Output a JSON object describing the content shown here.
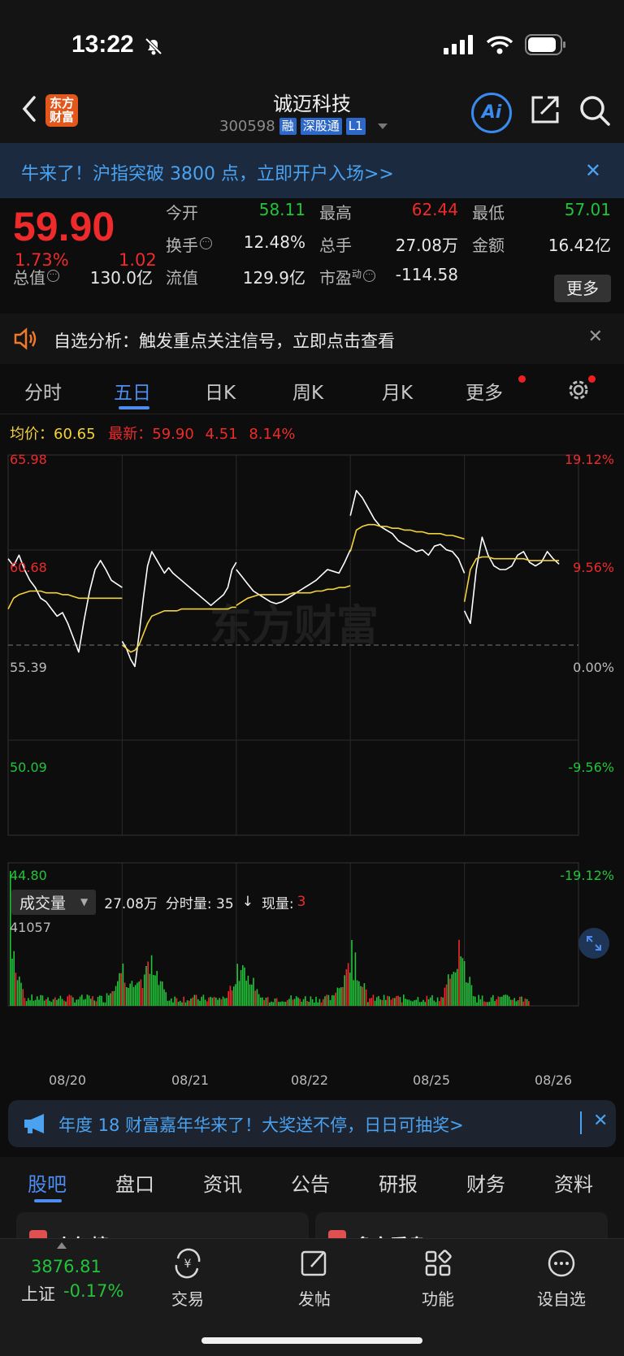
{
  "status": {
    "time": "13:22"
  },
  "header": {
    "logo_text_1": "东方",
    "logo_text_2": "财富",
    "stock_name": "诚迈科技",
    "stock_code": "300598",
    "tags": [
      "融",
      "深股通",
      "L1"
    ],
    "ai_label": "Ai"
  },
  "banner": {
    "text": "牛来了！沪指突破 3800 点，立即开户入场>>",
    "close": "✕"
  },
  "quote": {
    "price": "59.90",
    "change_pct": "1.73%",
    "change": "1.02",
    "open_label": "今开",
    "open": "58.11",
    "high_label": "最高",
    "high": "62.44",
    "low_label": "最低",
    "low": "57.01",
    "turnover_label": "换手",
    "turnover": "12.48%",
    "volume_label": "总手",
    "volume": "27.08万",
    "amount_label": "金额",
    "amount": "16.42亿",
    "mktcap_label": "总值",
    "mktcap": "130.0亿",
    "float_label": "流值",
    "float_cap": "129.9亿",
    "pe_label": "市盈",
    "pe_sup": "动",
    "pe": "-114.58",
    "more_label": "更多"
  },
  "alert": {
    "text": "自选分析：触发重点关注信号，立即点击查看",
    "close": "✕"
  },
  "tabs": [
    "分时",
    "五日",
    "日K",
    "周K",
    "月K",
    "更多"
  ],
  "active_tab": "五日",
  "summary": {
    "avg_label": "均价：",
    "avg": "60.65",
    "latest_label": "最新：",
    "latest": "59.90",
    "chg": "4.51",
    "chg_pct": "8.14%"
  },
  "chart_data": {
    "type": "line",
    "title": "",
    "x_labels": [
      "08/20",
      "08/21",
      "08/22",
      "08/25",
      "08/26"
    ],
    "y_ticks": [
      "65.98",
      "60.68",
      "55.39",
      "50.09",
      "44.80"
    ],
    "y_pct_ticks": [
      "19.12%",
      "9.56%",
      "0.00%",
      "-9.56%",
      "-19.12%"
    ],
    "ylim": [
      44.8,
      65.98
    ],
    "prev_close": 55.39,
    "series": [
      {
        "name": "",
        "color": "#ffffff",
        "values": [
          60.2,
          59.8,
          60.4,
          59.6,
          59.0,
          58.6,
          58.0,
          57.8,
          57.4,
          57.0,
          57.2,
          56.6,
          55.8,
          55.0,
          56.8,
          58.4,
          59.6,
          60.1,
          59.6,
          59.0,
          58.8,
          58.6,
          55.6,
          55.2,
          54.6,
          54.2,
          56.0,
          58.0,
          59.8,
          60.6,
          60.2,
          59.8,
          59.4,
          59.7,
          59.4,
          59.2,
          59.0,
          58.8,
          58.6,
          58.4,
          58.2,
          58.0,
          57.8,
          57.6,
          57.8,
          58.0,
          58.2,
          58.6,
          59.6,
          60.0,
          59.6,
          59.2,
          58.8,
          58.4,
          58.2,
          58.0,
          57.8,
          57.7,
          57.8,
          58.0,
          58.2,
          58.4,
          58.6,
          58.8,
          59.0,
          59.3,
          59.6,
          59.5,
          59.4,
          60.0,
          60.7,
          62.6,
          64.0,
          63.6,
          63.0,
          62.4,
          62.0,
          61.8,
          61.6,
          61.2,
          61.0,
          60.8,
          60.6,
          60.7,
          60.4,
          60.9,
          61.0,
          60.7,
          60.6,
          60.2,
          59.4,
          57.3,
          56.6,
          59.6,
          61.4,
          60.4,
          59.8,
          59.6,
          59.6,
          59.8,
          60.4,
          60.6,
          60.0,
          59.8,
          60.0,
          60.6,
          60.2,
          59.9
        ]
      },
      {
        "name": "",
        "color": "#f3d13a",
        "values": [
          57.4,
          58.0,
          58.2,
          58.3,
          58.4,
          58.4,
          58.4,
          58.3,
          58.3,
          58.3,
          58.2,
          58.2,
          58.1,
          58.0,
          58.0,
          58.0,
          58.0,
          58.0,
          58.0,
          58.0,
          58.0,
          58.0,
          55.4,
          55.2,
          55.0,
          55.1,
          55.4,
          56.0,
          56.6,
          57.0,
          57.1,
          57.2,
          57.3,
          57.3,
          57.3,
          57.3,
          57.4,
          57.4,
          57.4,
          57.4,
          57.4,
          57.4,
          57.4,
          57.4,
          57.4,
          57.4,
          57.4,
          57.4,
          57.5,
          57.5,
          57.6,
          57.8,
          58.0,
          58.1,
          58.2,
          58.2,
          58.2,
          58.2,
          58.2,
          58.2,
          58.3,
          58.3,
          58.3,
          58.3,
          58.4,
          58.4,
          58.5,
          58.5,
          58.6,
          58.6,
          58.7,
          60.6,
          61.8,
          62.0,
          62.1,
          62.1,
          62.0,
          62.0,
          61.9,
          61.9,
          61.8,
          61.8,
          61.7,
          61.7,
          61.6,
          61.6,
          61.6,
          61.5,
          61.5,
          61.4,
          61.3,
          57.8,
          59.6,
          60.2,
          60.3,
          60.3,
          60.2,
          60.2,
          60.2,
          60.2,
          60.2,
          60.2,
          60.1,
          60.1,
          60.1,
          60.1,
          60.1,
          60.1
        ]
      }
    ],
    "grid": true
  },
  "volume": {
    "selector_label": "成交量",
    "total": "27.08万",
    "tick_label": "分时量: 35",
    "arrow": "↓",
    "now_label": "现量:",
    "now_val": "3",
    "max": "41057"
  },
  "promo": {
    "text": "年度 18 财富嘉年华来了！大奖送不停，日日可抽奖>",
    "close": "✕"
  },
  "bottom_tabs": [
    "股吧",
    "盘口",
    "资讯",
    "公告",
    "研报",
    "财务",
    "资料"
  ],
  "cards": [
    "人气榜",
    "多空看盘"
  ],
  "toolbar": {
    "index_value": "3876.81",
    "index_name": "上证",
    "index_pct": "-0.17%",
    "items": [
      "交易",
      "发帖",
      "功能",
      "设自选"
    ]
  },
  "watermark": "东方财富"
}
